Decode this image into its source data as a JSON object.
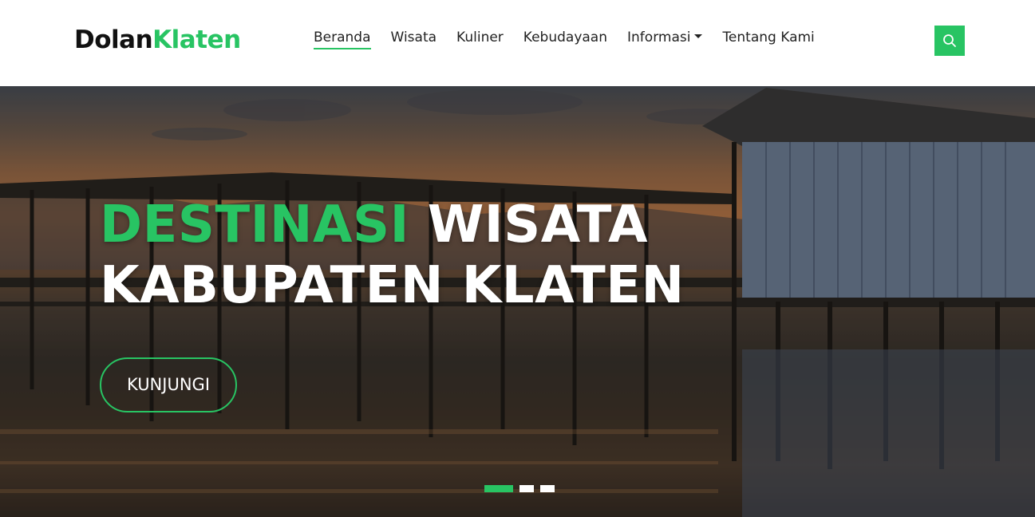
{
  "brand": {
    "name_part1": "Dolan",
    "name_part2": "Klaten"
  },
  "nav": {
    "items": [
      {
        "label": "Beranda",
        "active": true
      },
      {
        "label": "Wisata"
      },
      {
        "label": "Kuliner"
      },
      {
        "label": "Kebudayaan"
      },
      {
        "label": "Informasi",
        "dropdown": true
      },
      {
        "label": "Tentang Kami"
      }
    ]
  },
  "search": {
    "icon": "search-icon"
  },
  "hero": {
    "title_accent": "DESTINASI",
    "title_rest": "WISATA",
    "title_line2": "KABUPATEN KLATEN",
    "cta_label": "KUNJUNGI",
    "slides_count": 3,
    "active_slide": 1
  },
  "colors": {
    "accent": "#28c463",
    "text": "#222222",
    "background": "#ffffff"
  }
}
